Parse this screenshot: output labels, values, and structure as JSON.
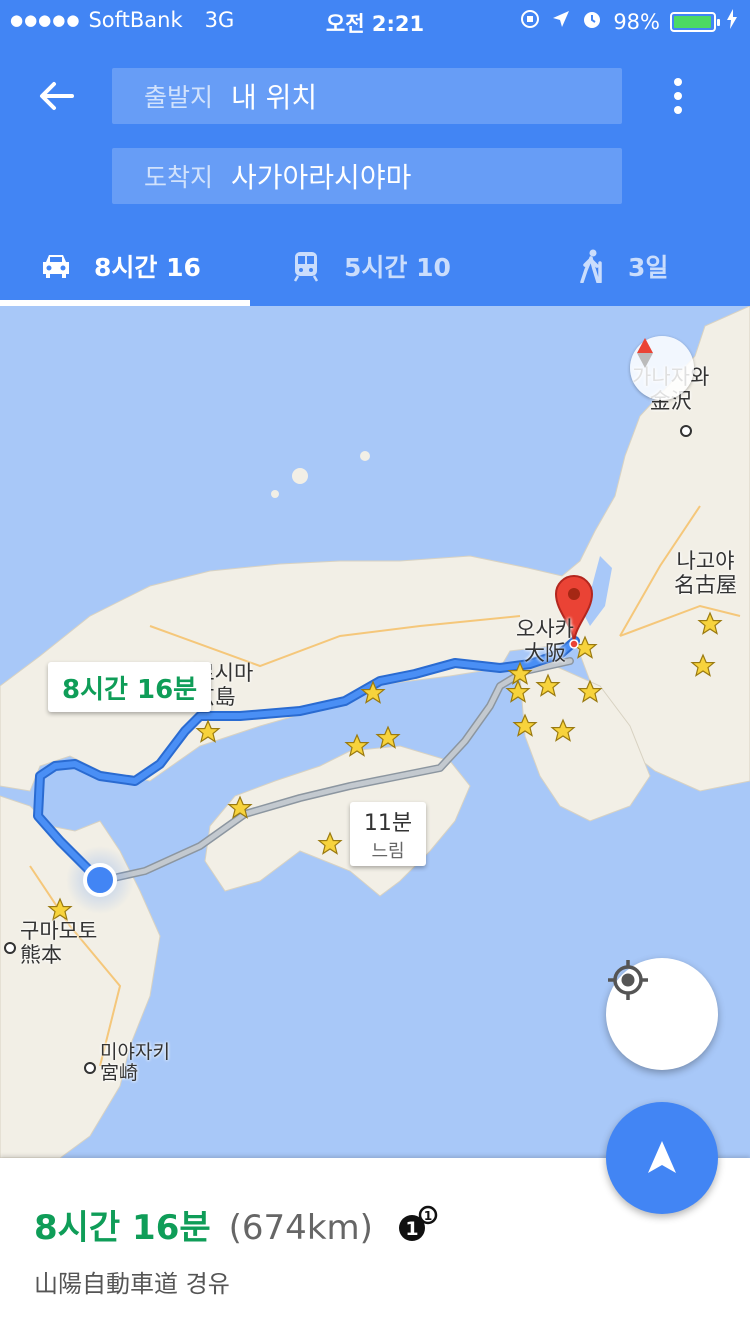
{
  "status_bar": {
    "carrier": "SoftBank",
    "network": "3G",
    "time": "오전 2:21",
    "battery": "98%",
    "battery_level": 0.98
  },
  "search": {
    "from_label": "출발지",
    "from_value": "내 위치",
    "to_label": "도착지",
    "to_value": "사가아라시야마"
  },
  "tabs": [
    {
      "mode": "car",
      "icon": "car-icon",
      "label": "8시간 16",
      "active": true
    },
    {
      "mode": "transit",
      "icon": "train-icon",
      "label": "5시간 10",
      "active": false
    },
    {
      "mode": "walk",
      "icon": "walk-icon",
      "label": "3일",
      "active": false
    }
  ],
  "map": {
    "labels": {
      "kanazawa": "가나자와\n金沢",
      "nagoya": "나고야\n名古屋",
      "osaka": "오사카\n大阪",
      "hiroshima": "히로시마\n広島",
      "kumamoto": "구마모토\n熊本",
      "miyazaki": "미야자키\n宮崎"
    },
    "route_callout": "8시간 16분",
    "alt_route_time": "11분",
    "alt_route_note": "느림",
    "colors": {
      "route": "#4285f4",
      "alt_route": "#a0a8b0",
      "water": "#a8c8f8",
      "land": "#f2efe6",
      "pin": "#ea4335"
    }
  },
  "summary": {
    "time": "8시간 16분",
    "distance": "(674km)",
    "via": "山陽自動車道 경유"
  }
}
